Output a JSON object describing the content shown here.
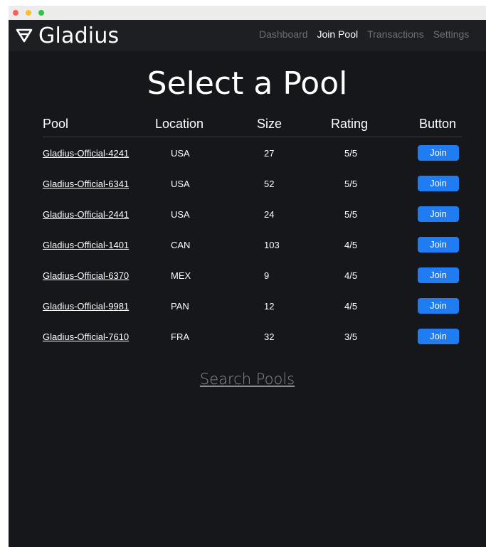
{
  "app": {
    "name": "Gladius"
  },
  "nav": {
    "items": [
      {
        "label": "Dashboard",
        "active": false
      },
      {
        "label": "Join Pool",
        "active": true
      },
      {
        "label": "Transactions",
        "active": false
      },
      {
        "label": "Settings",
        "active": false
      }
    ]
  },
  "page": {
    "title": "Select a Pool"
  },
  "table": {
    "headers": {
      "pool": "Pool",
      "location": "Location",
      "size": "Size",
      "rating": "Rating",
      "button": "Button"
    },
    "rows": [
      {
        "pool": "Gladius-Official-4241",
        "location": "USA",
        "size": "27",
        "rating": "5/5",
        "action": "Join"
      },
      {
        "pool": "Gladius-Official-6341",
        "location": "USA",
        "size": "52",
        "rating": "5/5",
        "action": "Join"
      },
      {
        "pool": "Gladius-Official-2441",
        "location": "USA",
        "size": "24",
        "rating": "5/5",
        "action": "Join"
      },
      {
        "pool": "Gladius-Official-1401",
        "location": "CAN",
        "size": "103",
        "rating": "4/5",
        "action": "Join"
      },
      {
        "pool": "Gladius-Official-6370",
        "location": "MEX",
        "size": "9",
        "rating": "4/5",
        "action": "Join"
      },
      {
        "pool": "Gladius-Official-9981",
        "location": "PAN",
        "size": "12",
        "rating": "4/5",
        "action": "Join"
      },
      {
        "pool": "Gladius-Official-7610",
        "location": "FRA",
        "size": "32",
        "rating": "3/5",
        "action": "Join"
      }
    ]
  },
  "search": {
    "label": "Search Pools"
  },
  "colors": {
    "background": "#16171b",
    "header": "#1e1f23",
    "accent": "#1f7cf2",
    "nav_inactive": "#6d6f76",
    "text": "#ffffff"
  },
  "icons": {
    "logo": "gladius-shield-icon"
  }
}
